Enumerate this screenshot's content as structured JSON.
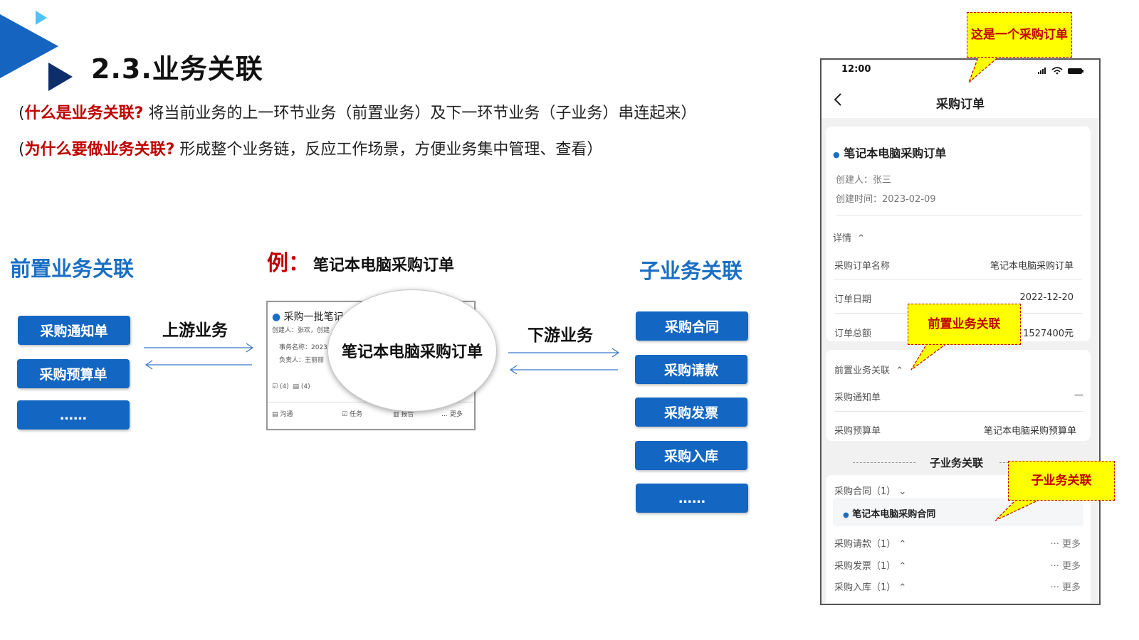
{
  "header": {
    "title": "2.3.业务关联",
    "line1_open": "(",
    "line1_question": "什么是业务关联?",
    "line1_text": "将当前业务的上一环节业务（前置业务）及下一环节业务（子业务）串连起来）",
    "line2_open": "(",
    "line2_question": "为什么要做业务关联?",
    "line2_text": "形成整个业务链，反应工作场景，方便业务集中管理、查看）"
  },
  "diagram": {
    "left_heading": "前置业务关联",
    "left_items": [
      "采购通知单",
      "采购预算单",
      "……"
    ],
    "upstream_label": "上游业务",
    "example_prefix": "例：",
    "example_title": "笔记本电脑采购订单",
    "downstream_label": "下游业务",
    "right_heading": "子业务关联",
    "right_items": [
      "采购合同",
      "采购请款",
      "采购发票",
      "采购入库",
      "……"
    ],
    "card": {
      "title": "采购一批笔记",
      "meta": "创建人：张欢，创建",
      "field1": "事务名称：2023",
      "field2": "负责人：王丽丽",
      "count1": "(4)",
      "count2": "(4)",
      "footer": [
        "沟通",
        "任务",
        "报告",
        "… 更多"
      ]
    },
    "bubble_text": "笔记本电脑采购订单"
  },
  "phone": {
    "time": "12:00",
    "nav_title": "采购订单",
    "order_title": "笔记本电脑采购订单",
    "creator": "创建人：张三",
    "created_time": "创建时间：2023-02-09",
    "details_label": "详情",
    "fields": [
      {
        "label": "采购订单名称",
        "value": "笔记本电脑采购订单"
      },
      {
        "label": "订单日期",
        "value": "2022-12-20"
      },
      {
        "label": "订单总额",
        "value": "1527400元"
      }
    ],
    "pre_section": "前置业务关联",
    "pre_items": [
      {
        "label": "采购通知单",
        "value": "—"
      },
      {
        "label": "采购预算单",
        "value": "笔记本电脑采购预算单"
      }
    ],
    "sub_section": "子业务关联",
    "sub_items": [
      {
        "label": "采购合同（1）",
        "expanded": true,
        "child": "笔记本电脑采购合同"
      },
      {
        "label": "采购请款（1）",
        "more": "··· 更多"
      },
      {
        "label": "采购发票（1）",
        "more": "··· 更多"
      },
      {
        "label": "采购入库（1）",
        "more": "··· 更多"
      }
    ]
  },
  "callouts": {
    "top": "这是一个采购订单",
    "pre": "前置业务关联",
    "sub": "子业务关联"
  },
  "colors": {
    "accent": "#1366c1",
    "highlight": "#c00000",
    "callout_bg": "#ffff00"
  }
}
